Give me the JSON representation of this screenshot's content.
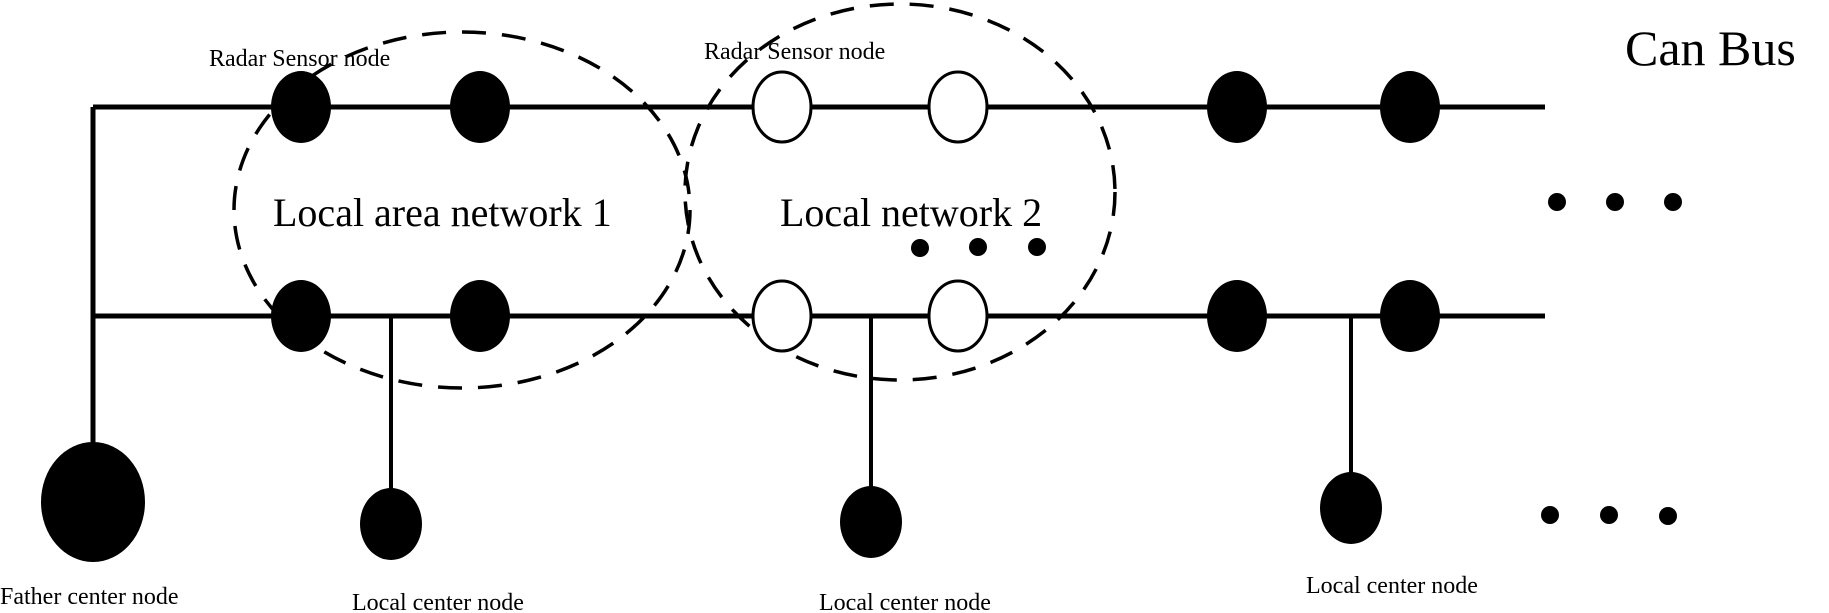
{
  "diagram": {
    "title": "Can Bus",
    "labels": {
      "radar_sensor_1": "Radar Sensor node",
      "radar_sensor_2": "Radar Sensor node",
      "network_1": "Local area network 1",
      "network_2": "Local network 2",
      "father_center": "Father center node",
      "local_center_1": "Local center node",
      "local_center_2": "Local center node",
      "local_center_3": "Local center node"
    },
    "buses": [
      {
        "name": "top-bus",
        "nodes": [
          "filled",
          "filled",
          "open",
          "open",
          "filled",
          "filled"
        ]
      },
      {
        "name": "bottom-bus",
        "nodes": [
          "filled",
          "filled",
          "open",
          "open",
          "filled",
          "filled"
        ]
      }
    ],
    "center_nodes": [
      "Father center node",
      "Local center node",
      "Local center node",
      "Local center node"
    ],
    "colors": {
      "ink": "#000000",
      "background": "#ffffff"
    },
    "ellipsis_markers": [
      "ellipsis-in-network-2",
      "ellipsis-right-middle",
      "ellipsis-right-bottom"
    ]
  }
}
